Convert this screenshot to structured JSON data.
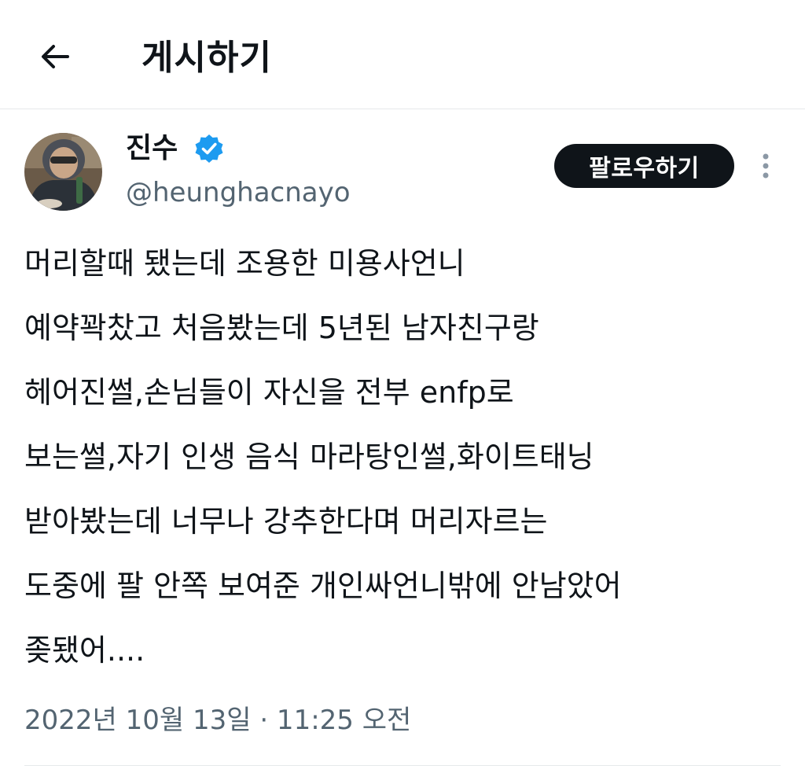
{
  "header": {
    "back_icon": "arrow-left-icon",
    "title": "게시하기"
  },
  "author": {
    "avatar_icon": "profile-photo",
    "display_name": "진수",
    "verified_icon": "verified-badge-icon",
    "handle": "@heunghacnayo"
  },
  "follow_button": {
    "label": "팔로우하기"
  },
  "more_icon": "more-vertical-icon",
  "tweet": {
    "lines": [
      "머리할때 됐는데 조용한 미용사언니",
      "예약꽉찼고 처음봤는데 5년된 남자친구랑",
      "헤어진썰,손님들이 자신을 전부 enfp로",
      "보는썰,자기 인생 음식 마라탕인썰,화이트태닝",
      "받아봤는데 너무나 강추한다며 머리자르는",
      "도중에 팔 안쪽 보여준 개인싸언니밖에 안남았어",
      "좆됐어...."
    ]
  },
  "timestamp": "2022년 10월 13일 · 11:25 오전",
  "colors": {
    "text": "#0f1419",
    "secondary_text": "#536471",
    "verified": "#1d9bf0",
    "follow_bg": "#0f1419",
    "divider": "#e6e9eb"
  }
}
